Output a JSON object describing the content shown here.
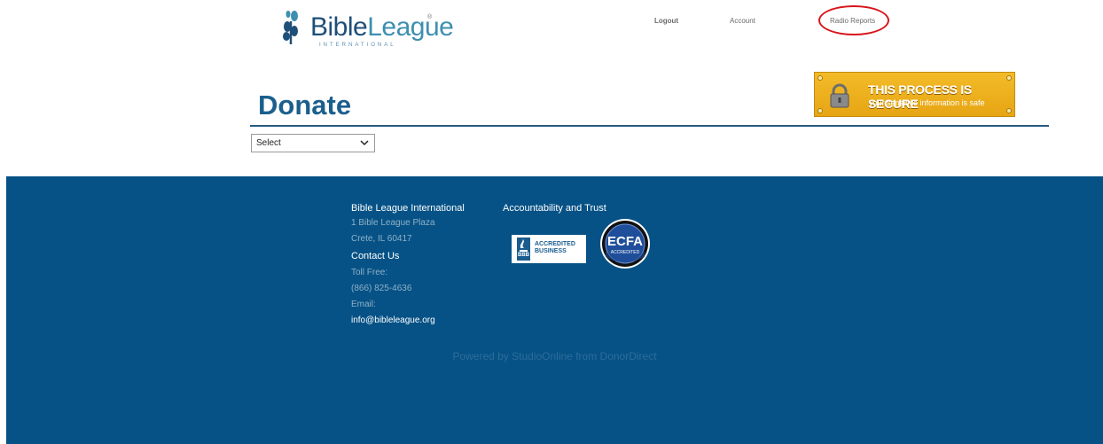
{
  "header": {
    "logo": {
      "name_part1": "Bible",
      "name_part2": "League",
      "registered": "®",
      "subtitle": "INTERNATIONAL"
    },
    "nav": {
      "logout": "Logout",
      "account": "Account",
      "radio_reports": "Radio Reports"
    },
    "annotation_color": "#d7141a"
  },
  "main": {
    "title": "Donate",
    "select": {
      "value": "Select"
    },
    "secure_badge": {
      "line1": "THIS PROCESS IS SECURE",
      "line2": "your sensitive information is safe"
    }
  },
  "footer": {
    "org_name": "Bible League International",
    "address1": "1 Bible League Plaza",
    "address2": "Crete, IL 60417",
    "contact_heading": "Contact Us",
    "toll_free_label": "Toll Free:",
    "phone": "(866) 825-4636",
    "email_label": "Email:",
    "email": "info@bibleleague.org",
    "accountability_heading": "Accountability and Trust",
    "bbb": {
      "line1": "ACCREDITED",
      "line2": "BUSINESS",
      "mark": "BBB"
    },
    "ecfa": {
      "name": "ECFA",
      "sub": "ACCREDITED"
    },
    "powered_by": "Powered by StudioOnline from DonorDirect"
  },
  "colors": {
    "brand_blue": "#1b5f8c",
    "footer_bg": "#065286",
    "secure_yellow": "#f0b21f"
  }
}
